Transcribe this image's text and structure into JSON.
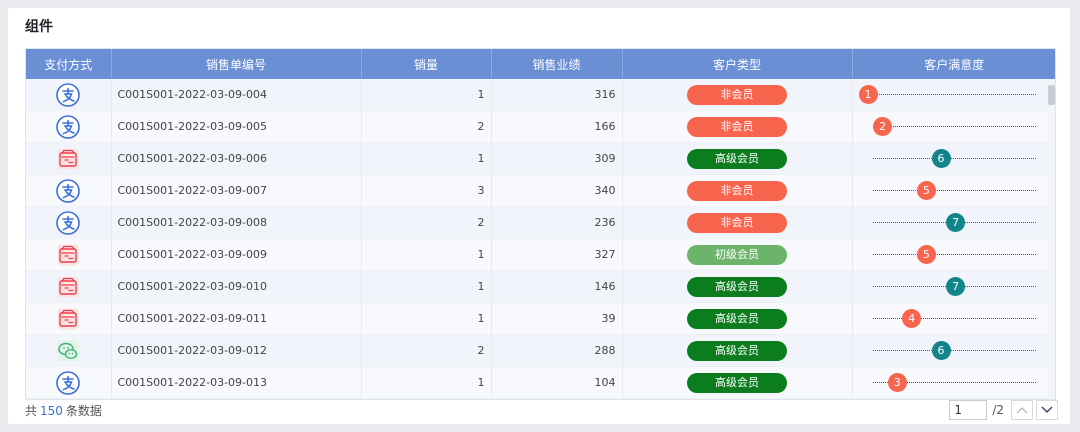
{
  "panel": {
    "title": "组件"
  },
  "table": {
    "columns": [
      "支付方式",
      "销售单编号",
      "销量",
      "销售业绩",
      "客户类型",
      "客户满意度"
    ],
    "rows": [
      {
        "payment": "alipay-icon",
        "order_id": "C001S001-2022-03-09-004",
        "qty": "1",
        "sales": "316",
        "customer_type": "非会员",
        "type_color": "#f7654f",
        "satisfaction": 1,
        "sat_color": "#f7654f"
      },
      {
        "payment": "alipay-icon",
        "order_id": "C001S001-2022-03-09-005",
        "qty": "2",
        "sales": "166",
        "customer_type": "非会员",
        "type_color": "#f7654f",
        "satisfaction": 2,
        "sat_color": "#f7654f"
      },
      {
        "payment": "card-icon",
        "order_id": "C001S001-2022-03-09-006",
        "qty": "1",
        "sales": "309",
        "customer_type": "高级会员",
        "type_color": "#0b7d1e",
        "satisfaction": 6,
        "sat_color": "#12858a"
      },
      {
        "payment": "alipay-icon",
        "order_id": "C001S001-2022-03-09-007",
        "qty": "3",
        "sales": "340",
        "customer_type": "非会员",
        "type_color": "#f7654f",
        "satisfaction": 5,
        "sat_color": "#f7654f"
      },
      {
        "payment": "alipay-icon",
        "order_id": "C001S001-2022-03-09-008",
        "qty": "2",
        "sales": "236",
        "customer_type": "非会员",
        "type_color": "#f7654f",
        "satisfaction": 7,
        "sat_color": "#12858a"
      },
      {
        "payment": "card-icon",
        "order_id": "C001S001-2022-03-09-009",
        "qty": "1",
        "sales": "327",
        "customer_type": "初级会员",
        "type_color": "#6cb36c",
        "satisfaction": 5,
        "sat_color": "#f7654f"
      },
      {
        "payment": "card-icon",
        "order_id": "C001S001-2022-03-09-010",
        "qty": "1",
        "sales": "146",
        "customer_type": "高级会员",
        "type_color": "#0b7d1e",
        "satisfaction": 7,
        "sat_color": "#12858a"
      },
      {
        "payment": "card-icon",
        "order_id": "C001S001-2022-03-09-011",
        "qty": "1",
        "sales": "39",
        "customer_type": "高级会员",
        "type_color": "#0b7d1e",
        "satisfaction": 4,
        "sat_color": "#f7654f"
      },
      {
        "payment": "wechat-icon",
        "order_id": "C001S001-2022-03-09-012",
        "qty": "2",
        "sales": "288",
        "customer_type": "高级会员",
        "type_color": "#0b7d1e",
        "satisfaction": 6,
        "sat_color": "#12858a"
      },
      {
        "payment": "alipay-icon",
        "order_id": "C001S001-2022-03-09-013",
        "qty": "1",
        "sales": "104",
        "customer_type": "高级会员",
        "type_color": "#0b7d1e",
        "satisfaction": 3,
        "sat_color": "#f7654f"
      }
    ]
  },
  "footer": {
    "total_prefix": "共",
    "total_count": "150",
    "total_suffix": "条数据"
  },
  "pager": {
    "current_page": "1",
    "total_pages": "/2"
  },
  "colors": {
    "header_bg": "#6a8fd4",
    "alipay": "#3a6fd8",
    "card": "#e8414b",
    "wechat": "#3cb371"
  }
}
